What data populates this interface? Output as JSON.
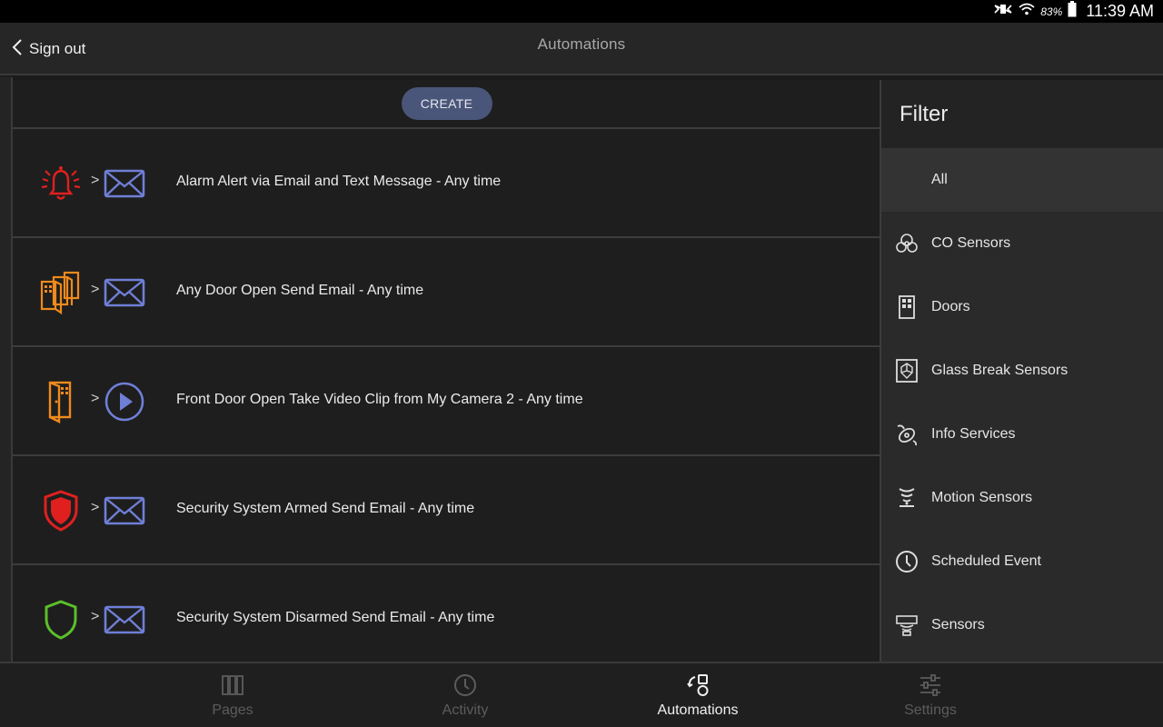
{
  "status_bar": {
    "battery_percent": "83%",
    "time": "11:39 AM"
  },
  "header": {
    "back_label": "Sign out",
    "title": "Automations"
  },
  "list": {
    "create_label": "CREATE",
    "rows": [
      {
        "trigger_icon": "alarm-bell-icon",
        "action_icon": "email-icon",
        "text": "Alarm Alert via Email and Text Message - Any time"
      },
      {
        "trigger_icon": "multiple-doors-icon",
        "action_icon": "email-icon",
        "text": "Any Door Open Send Email - Any time"
      },
      {
        "trigger_icon": "door-open-icon",
        "action_icon": "video-play-icon",
        "text": "Front Door Open Take Video Clip from My Camera 2 - Any time"
      },
      {
        "trigger_icon": "shield-armed-icon",
        "action_icon": "email-icon",
        "text": "Security System Armed Send Email - Any time"
      },
      {
        "trigger_icon": "shield-disarmed-icon",
        "action_icon": "email-icon",
        "text": "Security System Disarmed Send Email - Any time"
      }
    ],
    "arrow_glyph": ">"
  },
  "filter": {
    "title": "Filter",
    "items": [
      {
        "label": "All",
        "selected": true
      },
      {
        "label": "CO Sensors",
        "icon": "co-sensor-icon"
      },
      {
        "label": "Doors",
        "icon": "door-icon"
      },
      {
        "label": "Glass Break Sensors",
        "icon": "glass-break-icon"
      },
      {
        "label": "Info Services",
        "icon": "info-services-icon"
      },
      {
        "label": "Motion Sensors",
        "icon": "motion-sensor-icon"
      },
      {
        "label": "Scheduled Event",
        "icon": "clock-icon"
      },
      {
        "label": "Sensors",
        "icon": "sensors-icon"
      }
    ]
  },
  "bottom_nav": {
    "items": [
      {
        "label": "Pages",
        "icon": "pages-icon",
        "active": false
      },
      {
        "label": "Activity",
        "icon": "activity-clock-icon",
        "active": false
      },
      {
        "label": "Automations",
        "icon": "automations-icon",
        "active": true
      },
      {
        "label": "Settings",
        "icon": "settings-sliders-icon",
        "active": false
      }
    ]
  },
  "colors": {
    "accent_button": "#4a5679",
    "alarm_red": "#e0201f",
    "door_orange": "#f08a1c",
    "action_blue": "#6f7fd6",
    "disarmed_green": "#5bbf2a"
  }
}
